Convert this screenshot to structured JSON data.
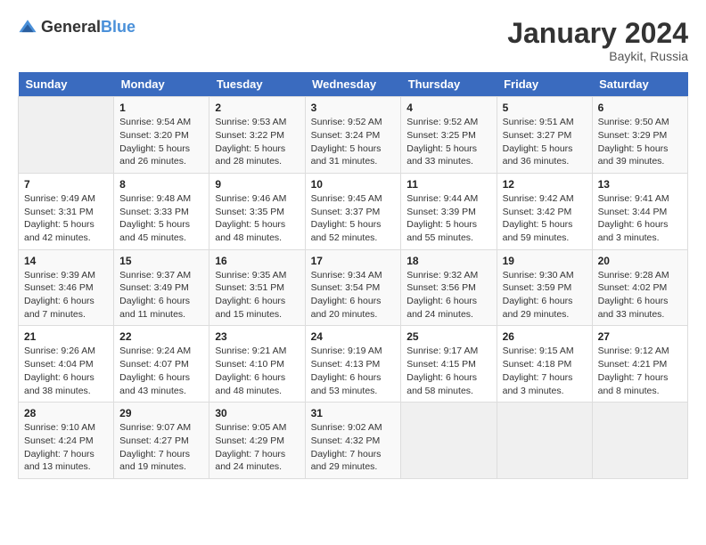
{
  "logo": {
    "text_general": "General",
    "text_blue": "Blue"
  },
  "title": "January 2024",
  "location": "Baykit, Russia",
  "days_of_week": [
    "Sunday",
    "Monday",
    "Tuesday",
    "Wednesday",
    "Thursday",
    "Friday",
    "Saturday"
  ],
  "weeks": [
    [
      {
        "day": "",
        "info": ""
      },
      {
        "day": "1",
        "info": "Sunrise: 9:54 AM\nSunset: 3:20 PM\nDaylight: 5 hours\nand 26 minutes."
      },
      {
        "day": "2",
        "info": "Sunrise: 9:53 AM\nSunset: 3:22 PM\nDaylight: 5 hours\nand 28 minutes."
      },
      {
        "day": "3",
        "info": "Sunrise: 9:52 AM\nSunset: 3:24 PM\nDaylight: 5 hours\nand 31 minutes."
      },
      {
        "day": "4",
        "info": "Sunrise: 9:52 AM\nSunset: 3:25 PM\nDaylight: 5 hours\nand 33 minutes."
      },
      {
        "day": "5",
        "info": "Sunrise: 9:51 AM\nSunset: 3:27 PM\nDaylight: 5 hours\nand 36 minutes."
      },
      {
        "day": "6",
        "info": "Sunrise: 9:50 AM\nSunset: 3:29 PM\nDaylight: 5 hours\nand 39 minutes."
      }
    ],
    [
      {
        "day": "7",
        "info": "Sunrise: 9:49 AM\nSunset: 3:31 PM\nDaylight: 5 hours\nand 42 minutes."
      },
      {
        "day": "8",
        "info": "Sunrise: 9:48 AM\nSunset: 3:33 PM\nDaylight: 5 hours\nand 45 minutes."
      },
      {
        "day": "9",
        "info": "Sunrise: 9:46 AM\nSunset: 3:35 PM\nDaylight: 5 hours\nand 48 minutes."
      },
      {
        "day": "10",
        "info": "Sunrise: 9:45 AM\nSunset: 3:37 PM\nDaylight: 5 hours\nand 52 minutes."
      },
      {
        "day": "11",
        "info": "Sunrise: 9:44 AM\nSunset: 3:39 PM\nDaylight: 5 hours\nand 55 minutes."
      },
      {
        "day": "12",
        "info": "Sunrise: 9:42 AM\nSunset: 3:42 PM\nDaylight: 5 hours\nand 59 minutes."
      },
      {
        "day": "13",
        "info": "Sunrise: 9:41 AM\nSunset: 3:44 PM\nDaylight: 6 hours\nand 3 minutes."
      }
    ],
    [
      {
        "day": "14",
        "info": "Sunrise: 9:39 AM\nSunset: 3:46 PM\nDaylight: 6 hours\nand 7 minutes."
      },
      {
        "day": "15",
        "info": "Sunrise: 9:37 AM\nSunset: 3:49 PM\nDaylight: 6 hours\nand 11 minutes."
      },
      {
        "day": "16",
        "info": "Sunrise: 9:35 AM\nSunset: 3:51 PM\nDaylight: 6 hours\nand 15 minutes."
      },
      {
        "day": "17",
        "info": "Sunrise: 9:34 AM\nSunset: 3:54 PM\nDaylight: 6 hours\nand 20 minutes."
      },
      {
        "day": "18",
        "info": "Sunrise: 9:32 AM\nSunset: 3:56 PM\nDaylight: 6 hours\nand 24 minutes."
      },
      {
        "day": "19",
        "info": "Sunrise: 9:30 AM\nSunset: 3:59 PM\nDaylight: 6 hours\nand 29 minutes."
      },
      {
        "day": "20",
        "info": "Sunrise: 9:28 AM\nSunset: 4:02 PM\nDaylight: 6 hours\nand 33 minutes."
      }
    ],
    [
      {
        "day": "21",
        "info": "Sunrise: 9:26 AM\nSunset: 4:04 PM\nDaylight: 6 hours\nand 38 minutes."
      },
      {
        "day": "22",
        "info": "Sunrise: 9:24 AM\nSunset: 4:07 PM\nDaylight: 6 hours\nand 43 minutes."
      },
      {
        "day": "23",
        "info": "Sunrise: 9:21 AM\nSunset: 4:10 PM\nDaylight: 6 hours\nand 48 minutes."
      },
      {
        "day": "24",
        "info": "Sunrise: 9:19 AM\nSunset: 4:13 PM\nDaylight: 6 hours\nand 53 minutes."
      },
      {
        "day": "25",
        "info": "Sunrise: 9:17 AM\nSunset: 4:15 PM\nDaylight: 6 hours\nand 58 minutes."
      },
      {
        "day": "26",
        "info": "Sunrise: 9:15 AM\nSunset: 4:18 PM\nDaylight: 7 hours\nand 3 minutes."
      },
      {
        "day": "27",
        "info": "Sunrise: 9:12 AM\nSunset: 4:21 PM\nDaylight: 7 hours\nand 8 minutes."
      }
    ],
    [
      {
        "day": "28",
        "info": "Sunrise: 9:10 AM\nSunset: 4:24 PM\nDaylight: 7 hours\nand 13 minutes."
      },
      {
        "day": "29",
        "info": "Sunrise: 9:07 AM\nSunset: 4:27 PM\nDaylight: 7 hours\nand 19 minutes."
      },
      {
        "day": "30",
        "info": "Sunrise: 9:05 AM\nSunset: 4:29 PM\nDaylight: 7 hours\nand 24 minutes."
      },
      {
        "day": "31",
        "info": "Sunrise: 9:02 AM\nSunset: 4:32 PM\nDaylight: 7 hours\nand 29 minutes."
      },
      {
        "day": "",
        "info": ""
      },
      {
        "day": "",
        "info": ""
      },
      {
        "day": "",
        "info": ""
      }
    ]
  ]
}
